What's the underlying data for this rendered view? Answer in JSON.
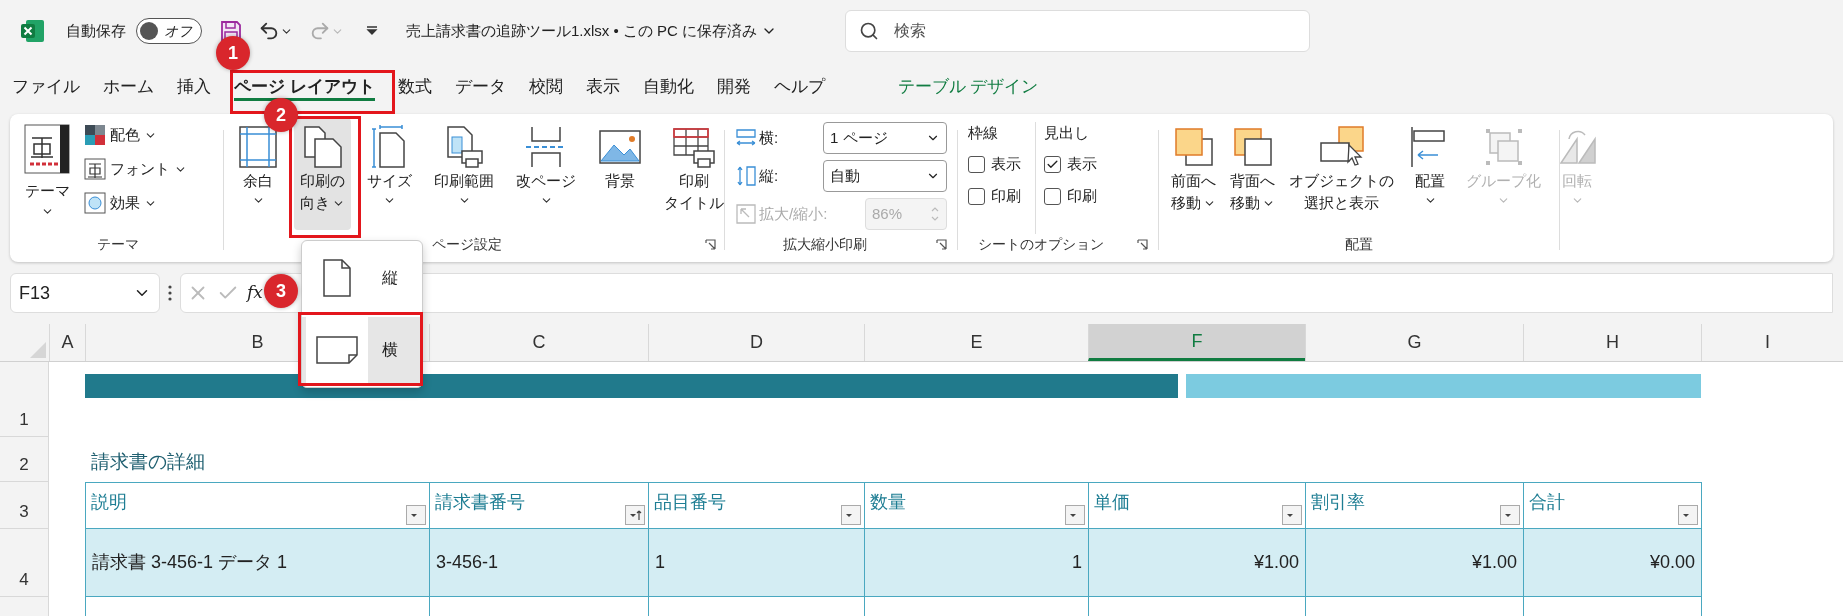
{
  "title_bar": {
    "autosave_label": "自動保存",
    "autosave_toggle": {
      "label": "オフ",
      "on": false
    },
    "filename": "売上請求書の追跡ツール1.xlsx • この PC に保存済み",
    "search": {
      "placeholder": "検索"
    }
  },
  "ribbon_tabs": [
    {
      "label": "ファイル",
      "selected": false,
      "kind": "normal"
    },
    {
      "label": "ホーム",
      "selected": false,
      "kind": "normal"
    },
    {
      "label": "挿入",
      "selected": false,
      "kind": "normal"
    },
    {
      "label": "ページ レイアウト",
      "selected": true,
      "kind": "normal"
    },
    {
      "label": "数式",
      "selected": false,
      "kind": "normal"
    },
    {
      "label": "データ",
      "selected": false,
      "kind": "normal"
    },
    {
      "label": "校閲",
      "selected": false,
      "kind": "normal"
    },
    {
      "label": "表示",
      "selected": false,
      "kind": "normal"
    },
    {
      "label": "自動化",
      "selected": false,
      "kind": "normal"
    },
    {
      "label": "開発",
      "selected": false,
      "kind": "normal"
    },
    {
      "label": "ヘルプ",
      "selected": false,
      "kind": "normal"
    },
    {
      "label": "テーブル デザイン",
      "selected": false,
      "kind": "contextual"
    }
  ],
  "theme_group": {
    "label": "テーマ",
    "big_button": "テーマ",
    "items": [
      {
        "label": "配色",
        "kind": "colors"
      },
      {
        "label": "フォント",
        "kind": "fonts"
      },
      {
        "label": "効果",
        "kind": "effects"
      }
    ]
  },
  "page_setup_group": {
    "label": "ページ設定",
    "buttons": [
      {
        "lines": [
          "余白"
        ],
        "has_menu": true,
        "kind": "margins",
        "selected": false
      },
      {
        "lines": [
          "印刷の",
          "向き"
        ],
        "has_menu": true,
        "kind": "orientation",
        "selected": true
      },
      {
        "lines": [
          "サイズ"
        ],
        "has_menu": true,
        "kind": "size",
        "selected": false
      },
      {
        "lines": [
          "印刷範囲"
        ],
        "has_menu": true,
        "kind": "print-area",
        "selected": false
      },
      {
        "lines": [
          "改ページ"
        ],
        "has_menu": true,
        "kind": "breaks",
        "selected": false
      },
      {
        "lines": [
          "背景"
        ],
        "has_menu": false,
        "kind": "background",
        "selected": false
      },
      {
        "lines": [
          "印刷",
          "タイトル"
        ],
        "has_menu": false,
        "kind": "print-titles",
        "selected": false
      }
    ]
  },
  "scale_group": {
    "label": "拡大縮小印刷",
    "rows": [
      {
        "label": "横:",
        "value": "1 ページ",
        "kind": "width",
        "disabled": false
      },
      {
        "label": "縦:",
        "value": "自動",
        "kind": "height",
        "disabled": false
      },
      {
        "label": "拡大/縮小:",
        "value": "86%",
        "kind": "scale",
        "disabled": true
      }
    ]
  },
  "sheet_options_group": {
    "label": "シートのオプション",
    "columns": [
      {
        "heading": "枠線",
        "options": [
          {
            "label": "表示",
            "checked": false
          },
          {
            "label": "印刷",
            "checked": false
          }
        ]
      },
      {
        "heading": "見出し",
        "options": [
          {
            "label": "表示",
            "checked": true
          },
          {
            "label": "印刷",
            "checked": false
          }
        ]
      }
    ]
  },
  "arrange_group": {
    "label": "配置",
    "buttons": [
      {
        "lines": [
          "前面へ",
          "移動"
        ],
        "has_menu": true,
        "kind": "forward",
        "disabled": false
      },
      {
        "lines": [
          "背面へ",
          "移動"
        ],
        "has_menu": true,
        "kind": "backward",
        "disabled": false
      },
      {
        "lines": [
          "オブジェクトの",
          "選択と表示"
        ],
        "has_menu": false,
        "kind": "selection",
        "disabled": false
      },
      {
        "lines": [
          "配置"
        ],
        "has_menu": true,
        "kind": "align",
        "disabled": false
      },
      {
        "lines": [
          "グループ化"
        ],
        "has_menu": true,
        "kind": "group",
        "disabled": true
      },
      {
        "lines": [
          "回転"
        ],
        "has_menu": true,
        "kind": "rotate",
        "disabled": true
      }
    ]
  },
  "orientation_menu": {
    "items": [
      {
        "label": "縦",
        "kind": "portrait",
        "selected": false
      },
      {
        "label": "横",
        "kind": "landscape",
        "selected": true
      }
    ]
  },
  "formula_bar": {
    "name_box": "F13",
    "function_label": "fx"
  },
  "sheet": {
    "columns": [
      {
        "label": "A",
        "selected": false
      },
      {
        "label": "B",
        "selected": false
      },
      {
        "label": "C",
        "selected": false
      },
      {
        "label": "D",
        "selected": false
      },
      {
        "label": "E",
        "selected": false
      },
      {
        "label": "F",
        "selected": true
      },
      {
        "label": "G",
        "selected": false
      },
      {
        "label": "H",
        "selected": false
      },
      {
        "label": "I",
        "selected": false
      }
    ],
    "rows": [
      "1",
      "2",
      "3",
      "4"
    ],
    "title": "請求書の詳細",
    "table": {
      "headers": [
        {
          "label": "説明",
          "sorted": false
        },
        {
          "label": "請求書番号",
          "sorted": true
        },
        {
          "label": "品目番号",
          "sorted": false
        },
        {
          "label": "数量",
          "sorted": false
        },
        {
          "label": "単価",
          "sorted": false
        },
        {
          "label": "割引率",
          "sorted": false
        },
        {
          "label": "合計",
          "sorted": false
        }
      ],
      "rows": [
        [
          {
            "text": "請求書 3-456-1 データ 1",
            "kind": "text"
          },
          {
            "text": "3-456-1",
            "kind": "text"
          },
          {
            "text": "1",
            "kind": "text"
          },
          {
            "text": "1",
            "kind": "number"
          },
          {
            "text": "¥1.00",
            "kind": "number"
          },
          {
            "text": "¥1.00",
            "kind": "number"
          },
          {
            "text": "¥0.00",
            "kind": "number"
          }
        ]
      ]
    }
  },
  "annotations": [
    {
      "label": "1"
    },
    {
      "label": "2"
    },
    {
      "label": "3"
    }
  ]
}
